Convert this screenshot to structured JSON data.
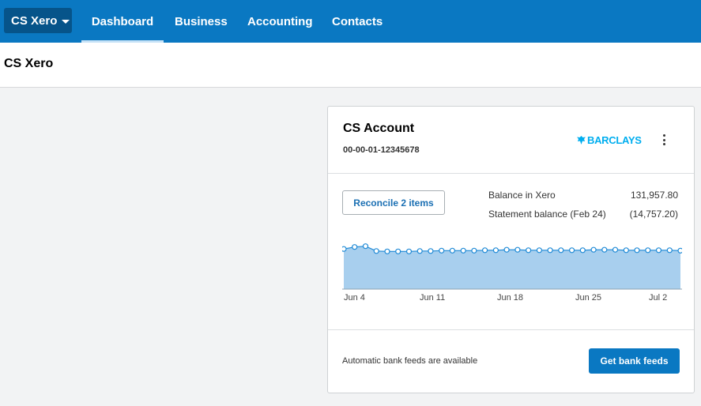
{
  "org_switcher": {
    "label": "CS Xero"
  },
  "nav": [
    {
      "label": "Dashboard",
      "active": true
    },
    {
      "label": "Business",
      "active": false
    },
    {
      "label": "Accounting",
      "active": false
    },
    {
      "label": "Contacts",
      "active": false
    }
  ],
  "page": {
    "title": "CS Xero"
  },
  "account_card": {
    "name": "CS Account",
    "number": "00-00-01-12345678",
    "bank_logo_text": "BARCLAYS",
    "reconcile_button": "Reconcile 2 items",
    "balance_in_xero_label": "Balance in Xero",
    "balance_in_xero_value": "131,957.80",
    "statement_balance_label": "Statement balance (Feb 24)",
    "statement_balance_value": "(14,757.20)",
    "feeds_text": "Automatic bank feeds are available",
    "feeds_button": "Get bank feeds"
  },
  "colors": {
    "nav_bg": "#0a78c2",
    "org_switch_bg": "#06548a",
    "chart_fill": "#a8cfee",
    "chart_line": "#1f8ad6",
    "bank_logo": "#00aeef"
  },
  "icons": {
    "org_caret": "caret-down-icon",
    "bank": "eagle-icon",
    "menu": "kebab-menu-icon"
  },
  "chart_data": {
    "type": "area",
    "x_ticks": [
      "Jun 4",
      "Jun 11",
      "Jun 18",
      "Jun 25",
      "Jul 2"
    ],
    "values": [
      1.0,
      1.05,
      1.07,
      0.95,
      0.94,
      0.94,
      0.94,
      0.95,
      0.95,
      0.96,
      0.96,
      0.96,
      0.96,
      0.97,
      0.97,
      0.98,
      0.98,
      0.97,
      0.97,
      0.97,
      0.97,
      0.97,
      0.97,
      0.98,
      0.98,
      0.98,
      0.97,
      0.97,
      0.97,
      0.97,
      0.97,
      0.96
    ],
    "ylim": [
      0,
      1.3
    ],
    "grid": false
  }
}
